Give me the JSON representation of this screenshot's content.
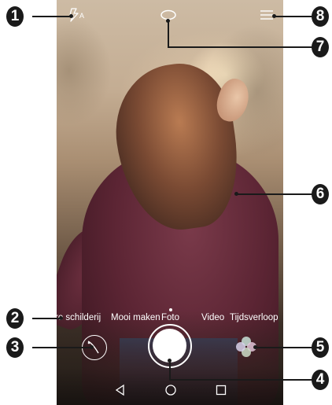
{
  "camera": {
    "flash_icon": "flash-auto-icon",
    "flash_label": "A",
    "top_center_icon": "capture-shape-icon",
    "menu_icon": "menu-icon"
  },
  "modes": {
    "items": [
      "re schilderij",
      "Mooi maken",
      "Foto",
      "Video",
      "Tijdsverloop"
    ],
    "selected": "Foto"
  },
  "controls": {
    "filter_icon": "filter-icon",
    "shutter": "shutter-button",
    "beauty_icon": "beauty-icon"
  },
  "navbar": {
    "back": "back-icon",
    "home": "home-icon",
    "recent": "recent-apps-icon"
  },
  "callouts": [
    "1",
    "2",
    "3",
    "4",
    "5",
    "6",
    "7",
    "8"
  ]
}
